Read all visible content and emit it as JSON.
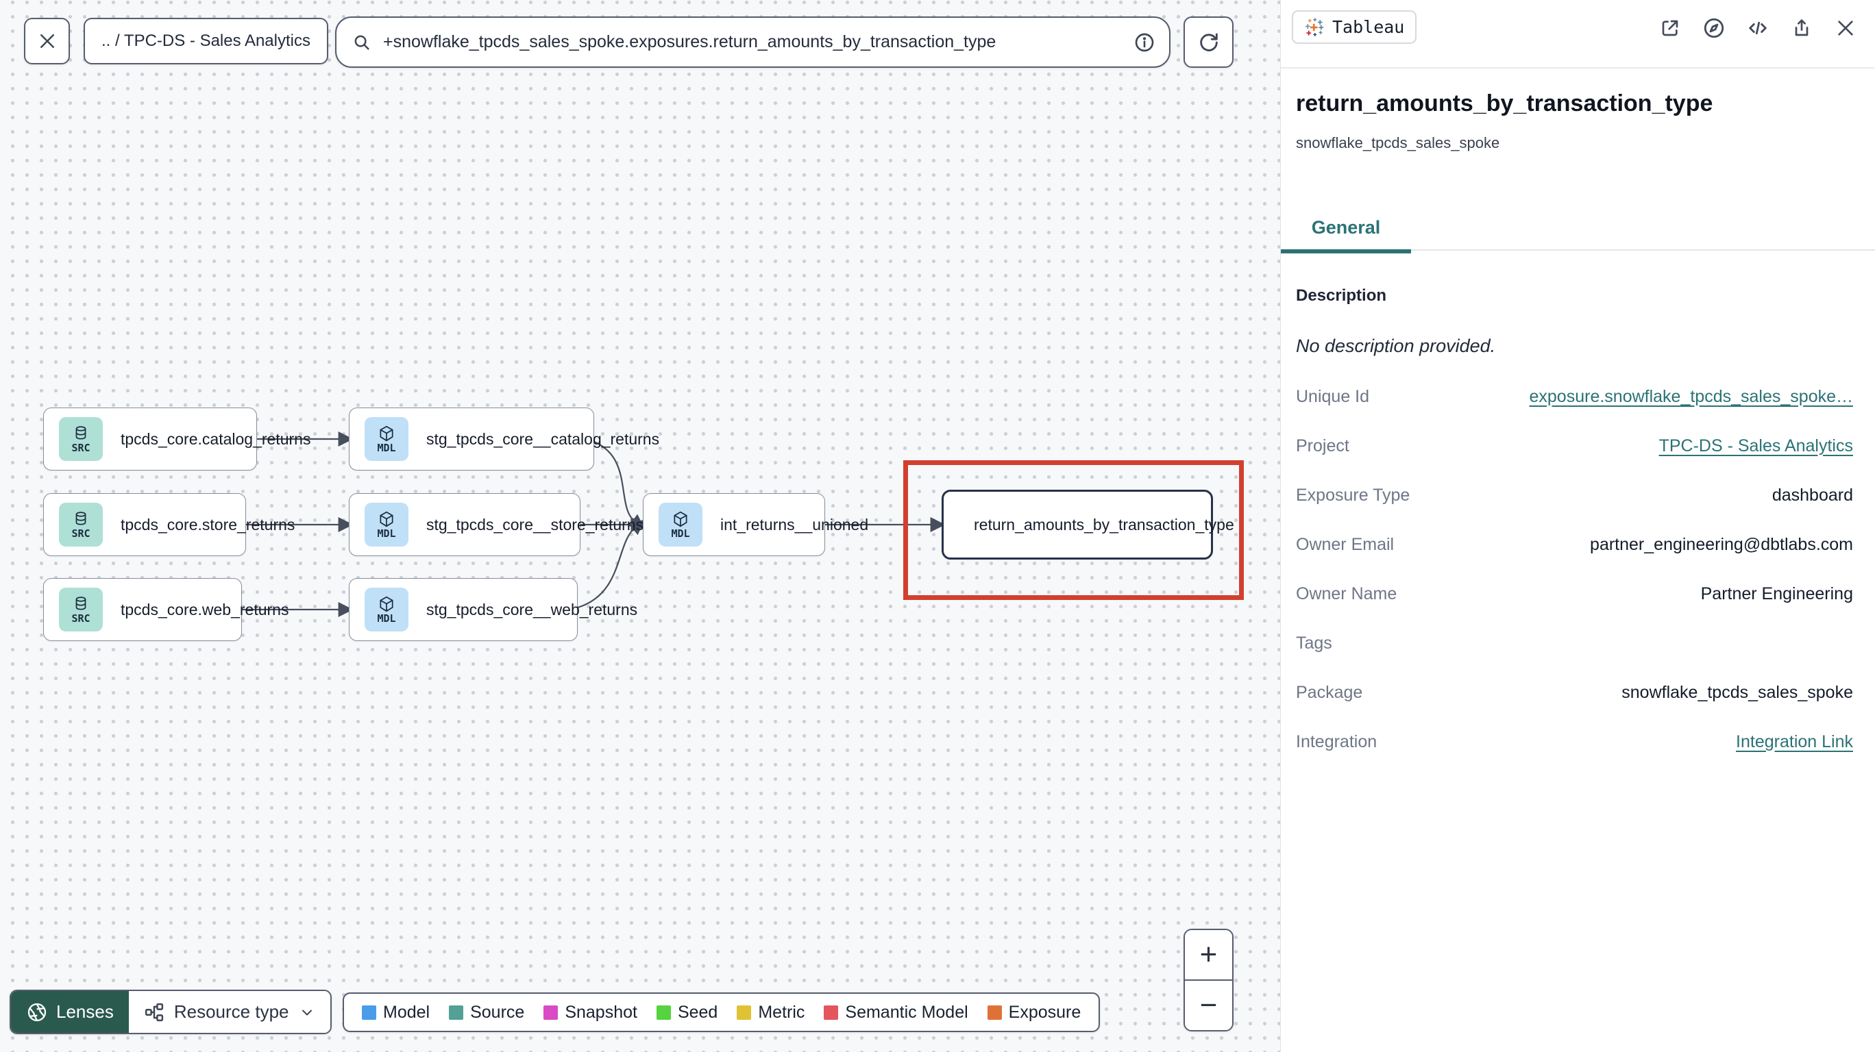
{
  "toolbar": {
    "breadcrumb": ".. / TPC-DS - Sales Analytics",
    "search_value": "+snowflake_tpcds_sales_spoke.exposures.return_amounts_by_transaction_type"
  },
  "panel": {
    "integration_badge": "Tableau",
    "title": "return_amounts_by_transaction_type",
    "subtitle": "snowflake_tpcds_sales_spoke",
    "tab_general": "General",
    "description_heading": "Description",
    "description_empty": "No description provided.",
    "fields": [
      {
        "label": "Unique Id",
        "value": "exposure.snowflake_tpcds_sales_spoke…",
        "link": true
      },
      {
        "label": "Project",
        "value": "TPC-DS - Sales Analytics",
        "link": true
      },
      {
        "label": "Exposure Type",
        "value": "dashboard",
        "link": false
      },
      {
        "label": "Owner Email",
        "value": "partner_engineering@dbtlabs.com",
        "link": false
      },
      {
        "label": "Owner Name",
        "value": "Partner Engineering",
        "link": false
      },
      {
        "label": "Tags",
        "value": "",
        "link": false
      },
      {
        "label": "Package",
        "value": "snowflake_tpcds_sales_spoke",
        "link": false
      },
      {
        "label": "Integration",
        "value": "Integration Link",
        "link": true
      }
    ]
  },
  "graph": {
    "nodes": [
      {
        "badge": "SRC",
        "label": "tpcds_core.catalog_returns"
      },
      {
        "badge": "SRC",
        "label": "tpcds_core.store_returns"
      },
      {
        "badge": "SRC",
        "label": "tpcds_core.web_returns"
      },
      {
        "badge": "MDL",
        "label": "stg_tpcds_core__catalog_returns"
      },
      {
        "badge": "MDL",
        "label": "stg_tpcds_core__store_returns"
      },
      {
        "badge": "MDL",
        "label": "stg_tpcds_core__web_returns"
      },
      {
        "badge": "MDL",
        "label": "int_returns__unioned"
      },
      {
        "badge": "",
        "label": "return_amounts_by_transaction_type"
      }
    ]
  },
  "legend": {
    "items": [
      {
        "label": "Model",
        "color": "#4a9ce8"
      },
      {
        "label": "Source",
        "color": "#53a097"
      },
      {
        "label": "Snapshot",
        "color": "#d94ac5"
      },
      {
        "label": "Seed",
        "color": "#55d43f"
      },
      {
        "label": "Metric",
        "color": "#e0c233"
      },
      {
        "label": "Semantic Model",
        "color": "#e4555e"
      },
      {
        "label": "Exposure",
        "color": "#df7138"
      }
    ]
  },
  "footer": {
    "lenses_label": "Lenses",
    "resource_type_label": "Resource type"
  },
  "zoom_controls": {
    "zoom_in": "+",
    "zoom_out": "−"
  },
  "colors": {
    "accent_teal": "#2b7276",
    "highlight_red": "#d1402f",
    "lenses_green": "#2a5a4d",
    "src_badge_bg": "#aee0d6",
    "mdl_badge_bg": "#bfe0f7"
  }
}
